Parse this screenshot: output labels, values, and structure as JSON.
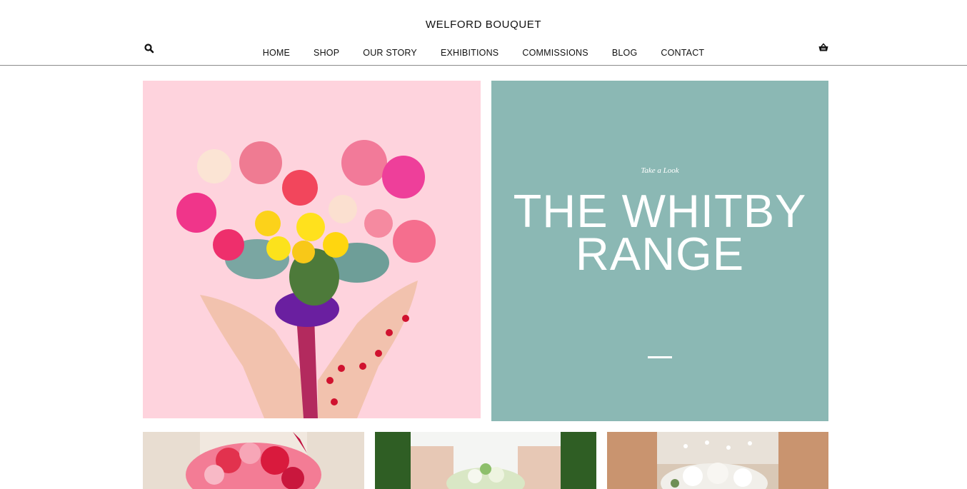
{
  "header": {
    "site_title": "WELFORD BOUQUET",
    "search_icon": "search-icon",
    "cart_icon": "basket-icon",
    "nav": [
      {
        "label": "HOME"
      },
      {
        "label": "SHOP"
      },
      {
        "label": "OUR STORY"
      },
      {
        "label": "EXHIBITIONS"
      },
      {
        "label": "COMMISSIONS"
      },
      {
        "label": "BLOG"
      },
      {
        "label": "CONTACT"
      }
    ]
  },
  "feature": {
    "eyebrow": "Take a Look",
    "title": "THE WHITBY RANGE",
    "background_color": "#8bb8b4"
  },
  "hero": {
    "image": "heart-shaped flower bouquet held in hands",
    "background_color": "#fed3dd"
  },
  "thumbnails": [
    {
      "image": "bride holding red and pink bouquet"
    },
    {
      "image": "bride holding white bouquet against greenery"
    },
    {
      "image": "bride holding white rose bouquet"
    }
  ]
}
